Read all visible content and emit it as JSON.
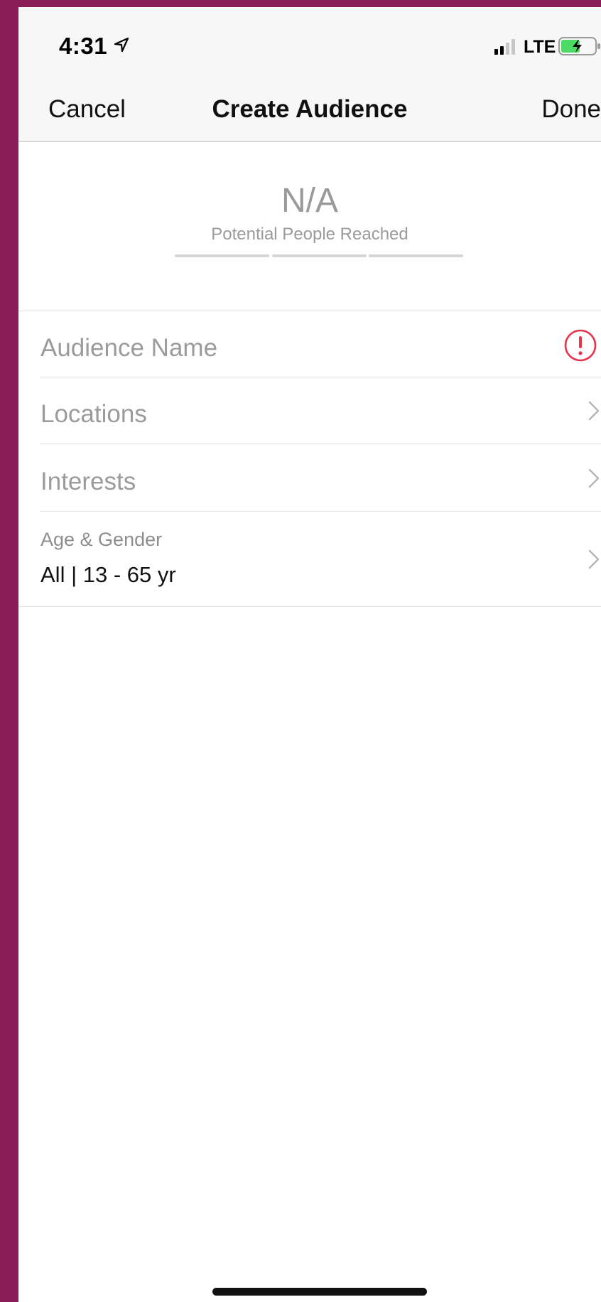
{
  "status_bar": {
    "time": "4:31",
    "carrier": "LTE",
    "location_icon": "location-arrow-icon",
    "signal_icon": "cellular-signal-icon",
    "battery_icon": "battery-charging-icon",
    "battery_color": "#4cd964"
  },
  "nav": {
    "cancel_label": "Cancel",
    "title": "Create Audience",
    "done_label": "Done"
  },
  "reach": {
    "value": "N/A",
    "label": "Potential People Reached"
  },
  "rows": {
    "audience_name": {
      "placeholder": "Audience Name",
      "alert_icon": "alert-circle-icon",
      "alert_color": "#e8364f"
    },
    "locations": {
      "label": "Locations"
    },
    "interests": {
      "label": "Interests"
    },
    "age_gender": {
      "label": "Age & Gender",
      "value": "All | 13 - 65 yr"
    }
  },
  "colors": {
    "background_frame": "#8a1d59",
    "bar_background": "#f7f7f7",
    "placeholder_text": "#9b9b9b"
  }
}
